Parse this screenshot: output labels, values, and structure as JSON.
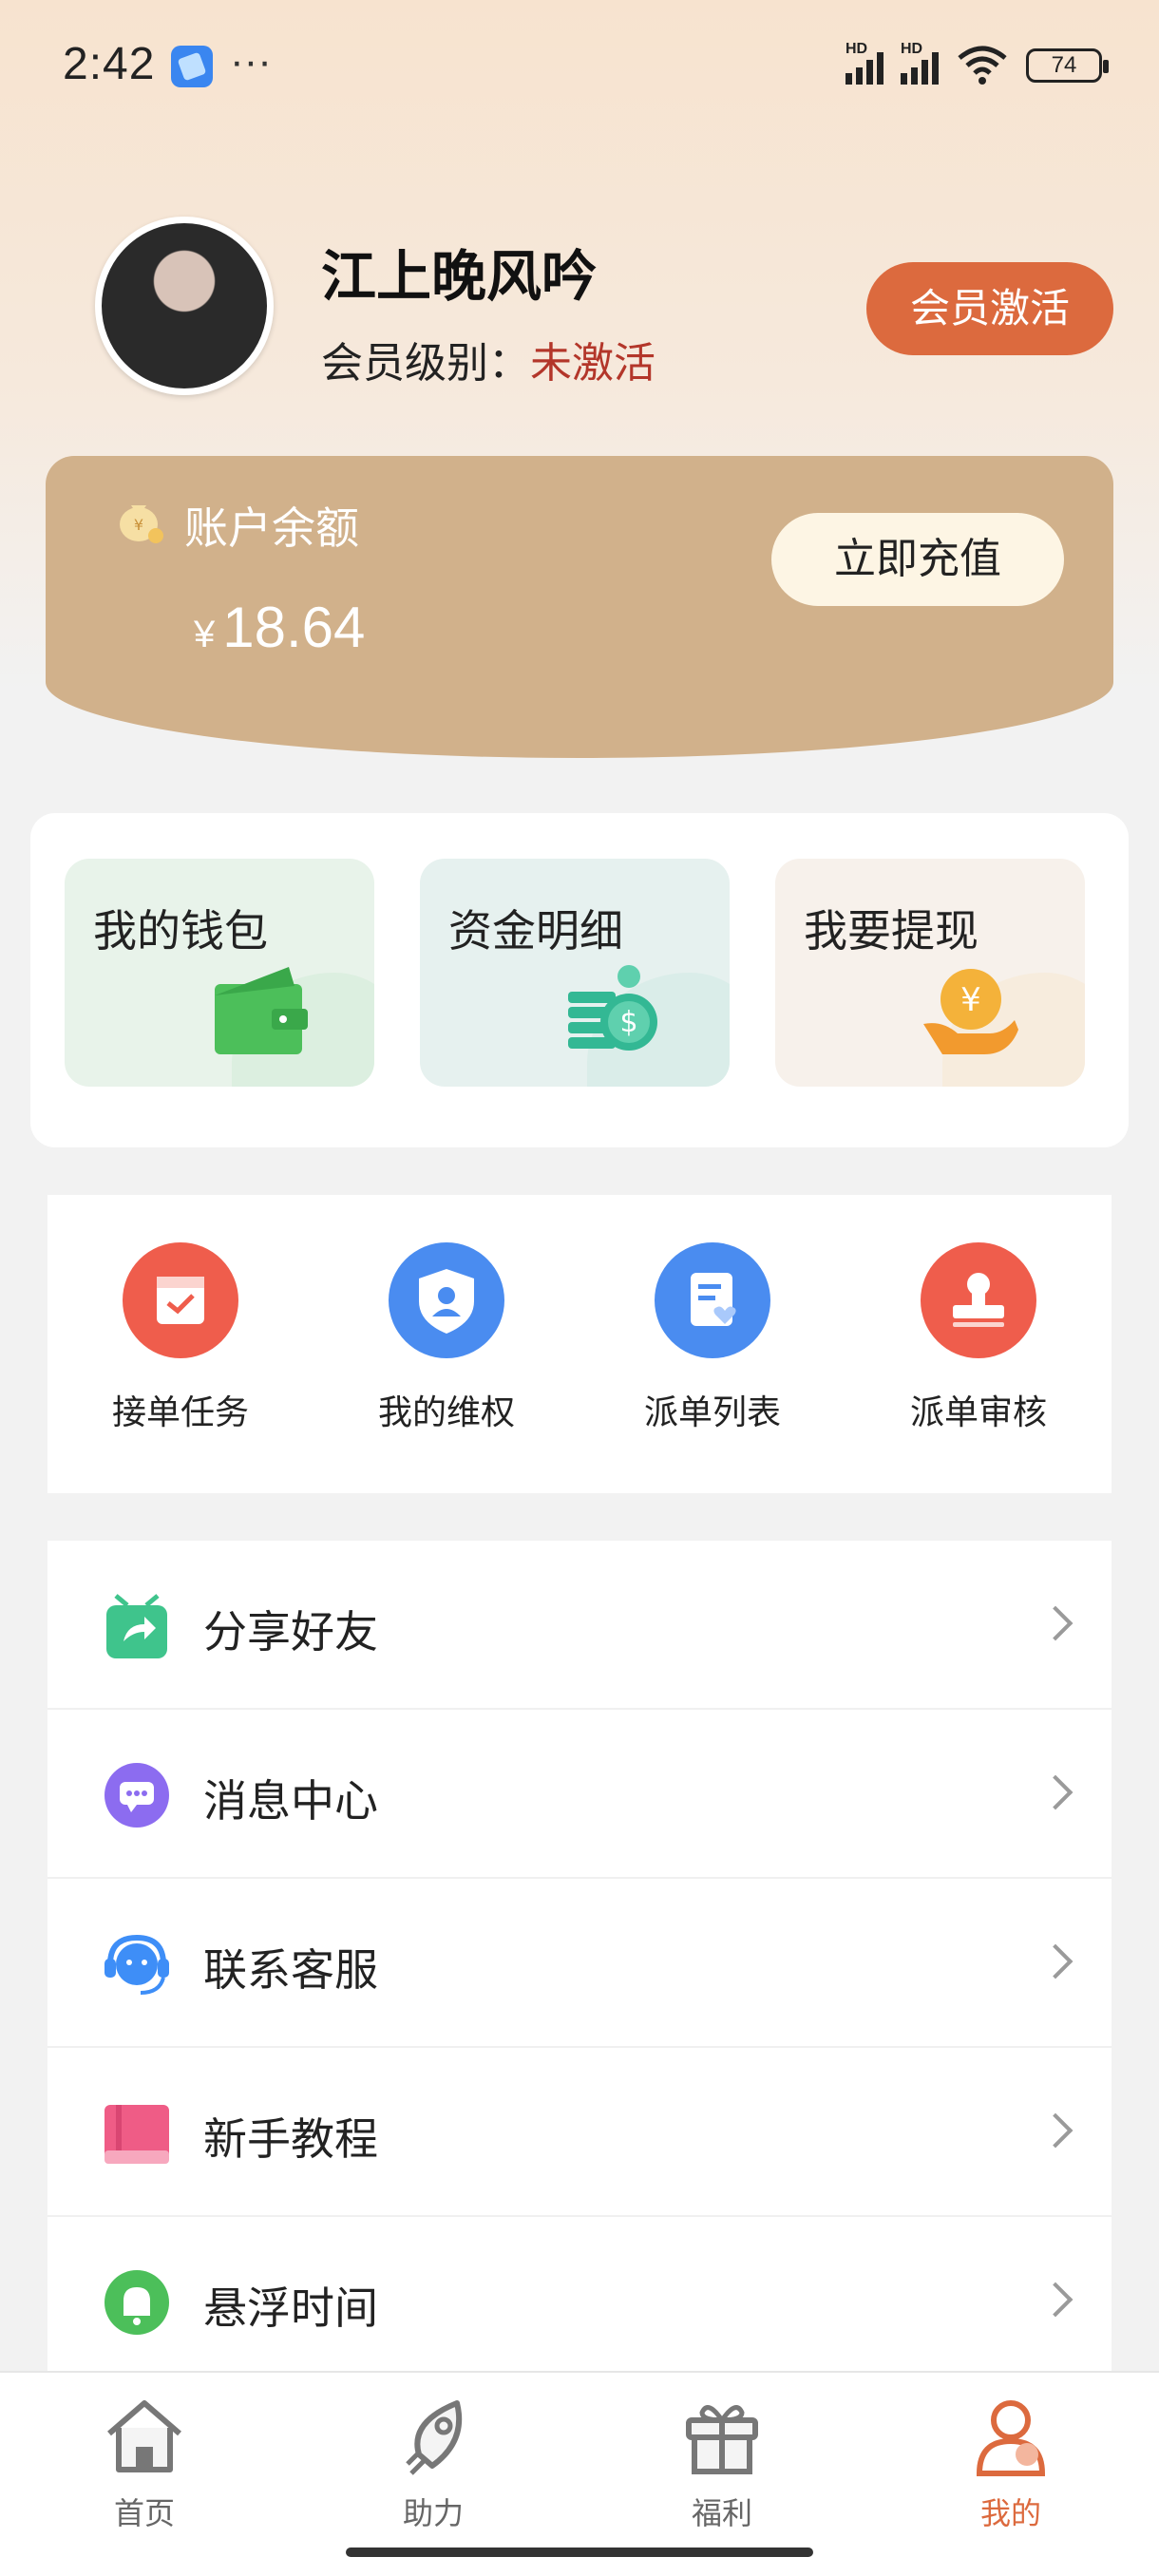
{
  "status_bar": {
    "time": "2:42",
    "dots": "···",
    "network_1": "HD",
    "network_2": "HD",
    "battery": "74"
  },
  "profile": {
    "username": "江上晚风吟",
    "member_level_label": "会员级别：",
    "member_level_value": "未激活",
    "activate_button": "会员激活"
  },
  "balance": {
    "label": "账户余额",
    "currency": "¥",
    "amount": "18.64",
    "recharge_button": "立即充值"
  },
  "wallet_cards": [
    {
      "label": "我的钱包",
      "icon": "wallet-icon",
      "color": "#4cbf5a"
    },
    {
      "label": "资金明细",
      "icon": "coins-icon",
      "color": "#33b894"
    },
    {
      "label": "我要提现",
      "icon": "withdraw-hand-icon",
      "color": "#f4b23a"
    }
  ],
  "quick_actions": [
    {
      "label": "接单任务",
      "icon": "calendar-check-icon",
      "color": "#ef5d4c"
    },
    {
      "label": "我的维权",
      "icon": "shield-user-icon",
      "color": "#4a8cf0"
    },
    {
      "label": "派单列表",
      "icon": "document-heart-icon",
      "color": "#4a8cf0"
    },
    {
      "label": "派单审核",
      "icon": "stamp-icon",
      "color": "#ef5d4c"
    }
  ],
  "menu": [
    {
      "label": "分享好友",
      "icon": "share-gift-icon",
      "color": "#3fc48c"
    },
    {
      "label": "消息中心",
      "icon": "message-icon",
      "color": "#8c6cf0"
    },
    {
      "label": "联系客服",
      "icon": "headset-icon",
      "color": "#3e8ef7"
    },
    {
      "label": "新手教程",
      "icon": "book-icon",
      "color": "#ef5c86"
    },
    {
      "label": "悬浮时间",
      "icon": "bell-icon",
      "color": "#4cbf5a"
    }
  ],
  "bottom_nav": [
    {
      "label": "首页",
      "icon": "home-icon",
      "active": false
    },
    {
      "label": "助力",
      "icon": "rocket-icon",
      "active": false
    },
    {
      "label": "福利",
      "icon": "gift-icon",
      "active": false
    },
    {
      "label": "我的",
      "icon": "user-icon",
      "active": true
    }
  ],
  "colors": {
    "accent": "#dc6a3e",
    "card_tan": "#d1b18b",
    "inactive_red": "#b3362a"
  }
}
